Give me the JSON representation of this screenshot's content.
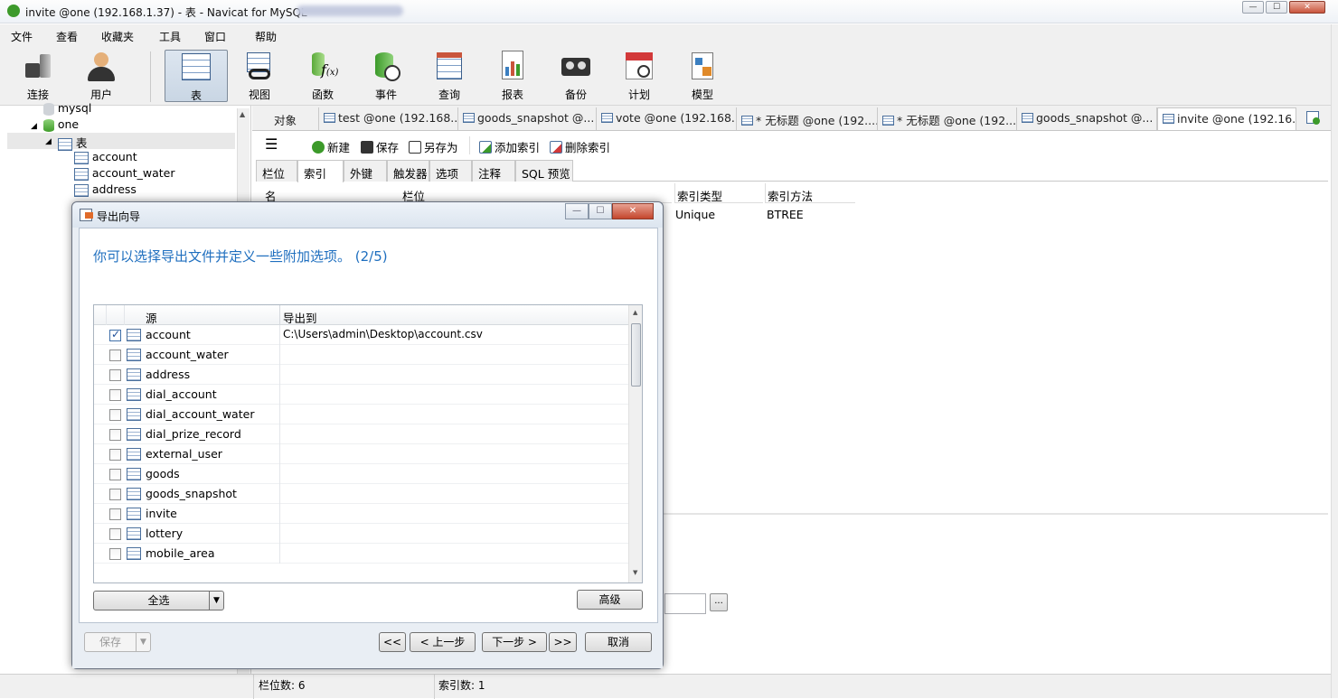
{
  "window": {
    "title": "invite @one (192.168.1.37) - 表 - Navicat for MySQL"
  },
  "menu": [
    "文件",
    "查看",
    "收藏夹",
    "工具",
    "窗口",
    "帮助"
  ],
  "toolbar": [
    {
      "label": "连接",
      "icon": "plug-icon"
    },
    {
      "label": "用户",
      "icon": "user-icon"
    },
    {
      "label": "表",
      "icon": "table-icon",
      "active": true
    },
    {
      "label": "视图",
      "icon": "view-glasses-icon"
    },
    {
      "label": "函数",
      "icon": "function-icon"
    },
    {
      "label": "事件",
      "icon": "event-clock-icon"
    },
    {
      "label": "查询",
      "icon": "query-icon"
    },
    {
      "label": "报表",
      "icon": "report-icon"
    },
    {
      "label": "备份",
      "icon": "backup-tape-icon"
    },
    {
      "label": "计划",
      "icon": "calendar-icon"
    },
    {
      "label": "模型",
      "icon": "model-icon"
    }
  ],
  "nav": {
    "items": [
      "mysql",
      "one",
      "表",
      "account",
      "account_water",
      "address"
    ]
  },
  "tabs": {
    "object": "对象",
    "items": [
      "test @one (192.168....",
      "goods_snapshot @...",
      "vote @one (192.168....",
      "* 无标题 @one (192....",
      "* 无标题 @one (192....",
      "goods_snapshot @...",
      "invite @one (192.16..."
    ]
  },
  "editor": {
    "buttons": [
      "新建",
      "保存",
      "另存为",
      "添加索引",
      "删除索引"
    ],
    "subtabs": [
      "栏位",
      "索引",
      "外键",
      "触发器",
      "选项",
      "注释",
      "SQL 预览"
    ],
    "grid": {
      "headers": [
        "名",
        "栏位",
        "索引类型",
        "索引方法"
      ],
      "row": {
        "type": "Unique",
        "method": "BTREE"
      }
    }
  },
  "status": {
    "fields": "栏位数: 6",
    "indexes": "索引数: 1"
  },
  "dialog": {
    "title": "导出向导",
    "heading": "你可以选择导出文件并定义一些附加选项。 (2/5)",
    "columns": {
      "source": "源",
      "export_to": "导出到"
    },
    "rows": [
      {
        "name": "account",
        "path": "C:\\Users\\admin\\Desktop\\account.csv",
        "checked": true
      },
      {
        "name": "account_water",
        "path": "",
        "checked": false
      },
      {
        "name": "address",
        "path": "",
        "checked": false
      },
      {
        "name": "dial_account",
        "path": "",
        "checked": false
      },
      {
        "name": "dial_account_water",
        "path": "",
        "checked": false
      },
      {
        "name": "dial_prize_record",
        "path": "",
        "checked": false
      },
      {
        "name": "external_user",
        "path": "",
        "checked": false
      },
      {
        "name": "goods",
        "path": "",
        "checked": false
      },
      {
        "name": "goods_snapshot",
        "path": "",
        "checked": false
      },
      {
        "name": "invite",
        "path": "",
        "checked": false
      },
      {
        "name": "lottery",
        "path": "",
        "checked": false
      },
      {
        "name": "mobile_area",
        "path": "",
        "checked": false
      }
    ],
    "select_all": "全选",
    "advanced": "高级",
    "save": "保存",
    "first": "<<",
    "prev": "< 上一步",
    "next": "下一步 >",
    "last": ">>",
    "cancel": "取消"
  },
  "colors": {
    "accent": "#1f6fbf",
    "selected_tab": "#ffffff",
    "chrome": "#f0f0f0"
  }
}
